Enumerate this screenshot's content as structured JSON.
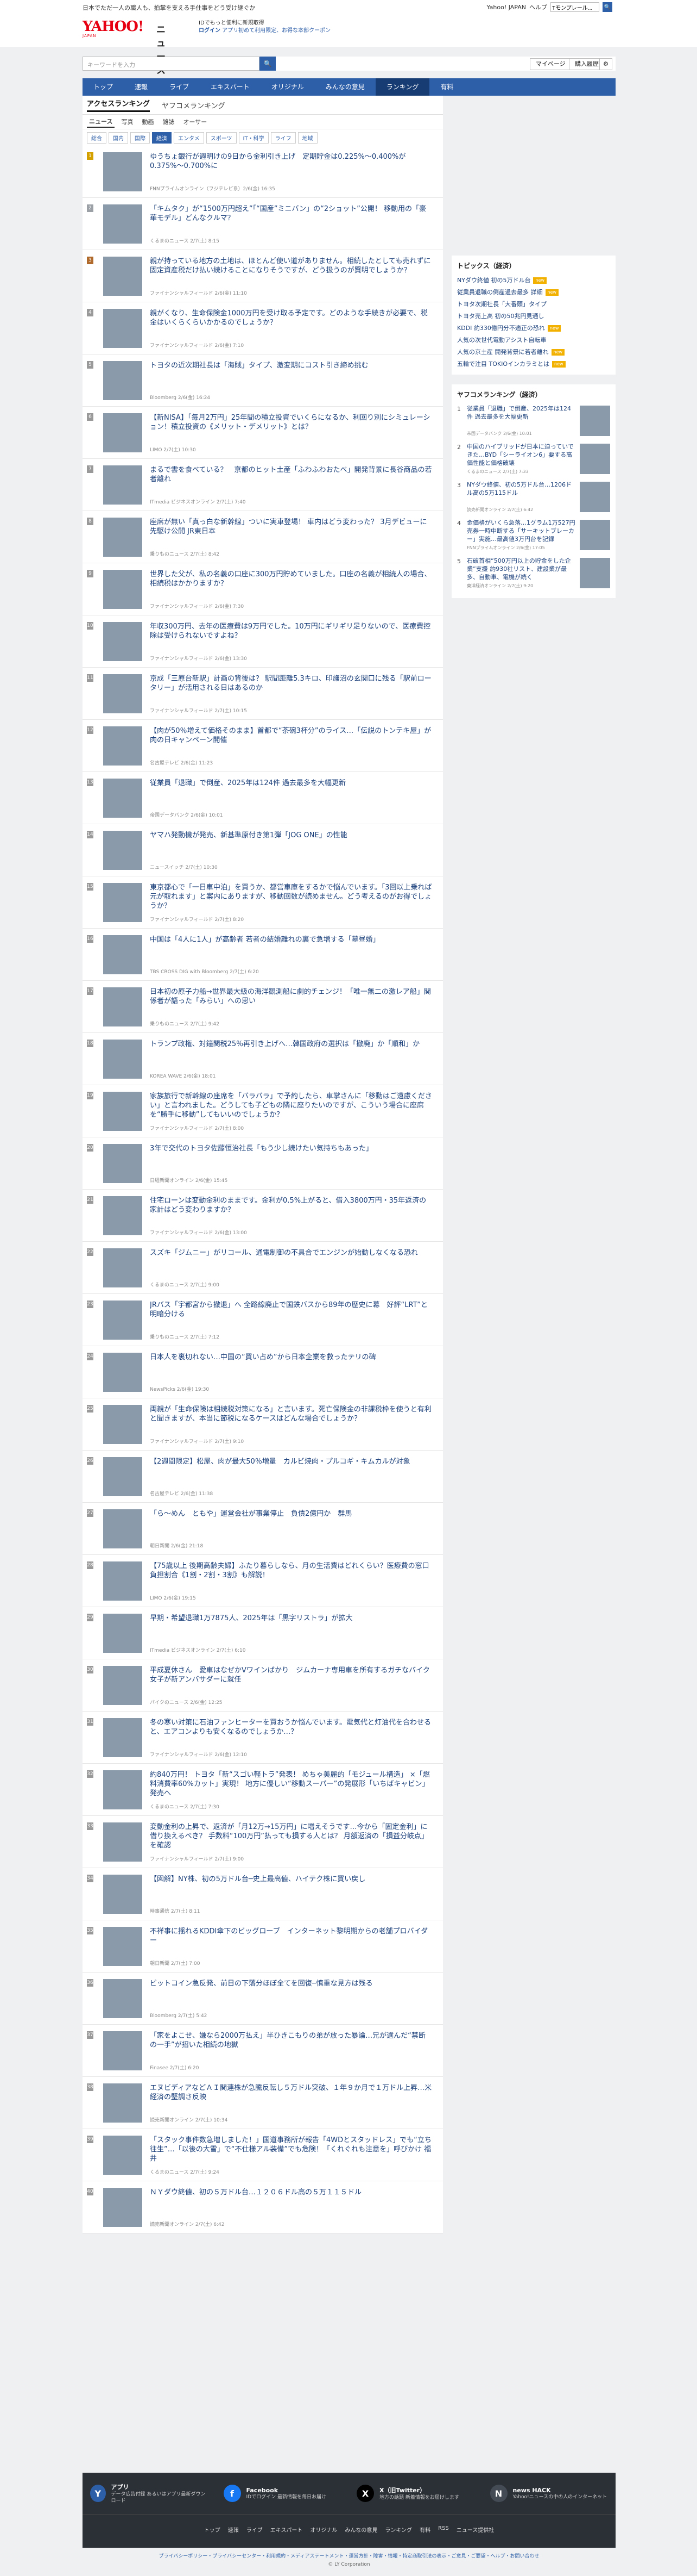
{
  "topbar": {
    "notice": "日本でただ一人の職人も、拍掌を支える手仕事をどう受け継ぐか",
    "links": [
      "Yahoo! JAPAN",
      "ヘルプ"
    ],
    "search_placeholder": "ウェブ検索",
    "search_value": "Tモンプレール..."
  },
  "header": {
    "logo_text": "YAHOO!",
    "logo_sub": "JAPAN",
    "service_name": "ニュース",
    "promo_line1": "IDでもっと便利に新規取得",
    "promo_login": "ログイン",
    "promo_line2": "アプリ初めて利用限定、お得な本部クーポン"
  },
  "searchbar": {
    "placeholder": "キーワードを入力",
    "mypage": "マイページ",
    "purchase": "購入履歴"
  },
  "nav": {
    "items": [
      "トップ",
      "速報",
      "ライブ",
      "エキスパート",
      "オリジナル",
      "みんなの意見",
      "ランキング",
      "有料"
    ],
    "active": "ランキング"
  },
  "ranking": {
    "tabs": [
      "アクセスランキング",
      "ヤフコメランキング"
    ],
    "sub_tabs": [
      "ニュース",
      "写真",
      "動画",
      "雑誌",
      "オーサー"
    ],
    "categories": [
      "総合",
      "国内",
      "国際",
      "経済",
      "エンタメ",
      "スポーツ",
      "IT・科学",
      "ライフ",
      "地域"
    ],
    "active_category": "経済",
    "items": [
      {
        "rank": "1",
        "title": "ゆうちょ銀行が週明けの9日から金利引き上げ　定期貯金は0.225%～0.400%が0.375%～0.700%に",
        "source": "FNNプライムオンライン（フジテレビ系）2/6(金) 16:35"
      },
      {
        "rank": "2",
        "title": "「キムタク」が“1500万円超え”「“国産”ミニバン」の“2ショット”公開！ 移動用の「豪華モデル」どんなクルマ？",
        "source": "くるまのニュース 2/7(土) 8:15"
      },
      {
        "rank": "3",
        "title": "親が持っている地方の土地は、ほとんど使い道がありません。相続したとしても売れずに固定資産税だけ払い続けることになりそうですが、どう扱うのが賢明でしょうか？",
        "source": "ファイナンシャルフィールド 2/6(金) 11:10"
      },
      {
        "rank": "4",
        "title": "親がくなり、生命保険金1000万円を受け取る予定です。どのような手続きが必要で、税金はいくらくらいかかるのでしょうか？",
        "source": "ファイナンシャルフィールド 2/6(金) 7:10"
      },
      {
        "rank": "5",
        "title": "トヨタの近次期社長は「海賊」タイプ、激変期にコスト引き締め挑む",
        "source": "Bloomberg 2/6(金) 16:24"
      },
      {
        "rank": "6",
        "title": "【新NISA】「毎月2万円」25年間の積立投資でいくらになるか、利回り別にシミュレーション！積立投資の《メリット・デメリット》とは？",
        "source": "LIMO 2/7(土) 10:30"
      },
      {
        "rank": "7",
        "title": "まるで雲を食べている？　京都のヒット土産「ふわふわおたべ」開発背景に長谷商品の若者離れ",
        "source": "ITmedia ビジネスオンライン 2/7(土) 7:40"
      },
      {
        "rank": "8",
        "title": "座席が無い「真っ白な新幹線」ついに実車登場！ 車内はどう変わった？ 3月デビューに先駆け公開 JR東日本",
        "source": "乗りものニュース 2/7(土) 8:42"
      },
      {
        "rank": "9",
        "title": "世界した父が、私の名義の口座に300万円貯めていました。口座の名義が相続人の場合、相続税はかかりますか？",
        "source": "ファイナンシャルフィールド 2/6(金) 7:30"
      },
      {
        "rank": "10",
        "title": "年収300万円、去年の医療費は9万円でした。10万円にギリギリ足りないので、医療費控除は受けられないですよね？",
        "source": "ファイナンシャルフィールド 2/6(金) 13:30"
      },
      {
        "rank": "11",
        "title": "京成「三原台新駅」計画の背後は？ 駅間距離5.3キロ、印旛沼の玄関口に残る「駅前ロータリー」が活用される日はあるのか",
        "source": "ファイナンシャルフィールド 2/7(土) 10:15"
      },
      {
        "rank": "12",
        "title": "【肉が50％増えて価格そのまま】首都で“茶碗3杯分”のライス…「伝説のトンテキ屋」が肉の日キャンペーン開催",
        "source": "名古屋テレビ 2/6(金) 11:23"
      },
      {
        "rank": "13",
        "title": "従業員「退職」で倒産、2025年は124件 過去最多を大幅更新",
        "source": "帝国データバンク 2/6(金) 10:01"
      },
      {
        "rank": "14",
        "title": "ヤマハ発動機が発売、新基準原付き第1弾「JOG ONE」の性能",
        "source": "ニュースイッチ 2/7(土) 10:30"
      },
      {
        "rank": "15",
        "title": "東京都心で「一日車中泊」を買うか、都営車庫をするかで悩んでいます。「3回以上乗れば元が取れます」と案内にありますが、移動回数が読めません。どう考えるのがお得でしょうか？",
        "source": "ファイナンシャルフィールド 2/7(土) 8:20"
      },
      {
        "rank": "16",
        "title": "中国は「4人に1人」が高齢者 若者の結婚離れの裏で急増する「墓昼婚」",
        "source": "TBS CROSS DIG with Bloomberg 2/7(土) 6:20"
      },
      {
        "rank": "17",
        "title": "日本初の原子力船→世界最大級の海洋観測船に劇的チェンジ！「唯一無二の激レア船」関係者が語った「みらい」への思い",
        "source": "乗りものニュース 2/7(土) 9:42"
      },
      {
        "rank": "18",
        "title": "トランプ政権、対鐘関税25％再引き上げへ…韓国政府の選択は「撤廃」か「順和」か",
        "source": "KOREA WAVE 2/6(金) 18:01"
      },
      {
        "rank": "19",
        "title": "家族旅行で新幹線の座席を「バラバラ」で予約したら、車掌さんに「移動はご遠慮ください」と言われました。どうしても子どもの隣に座りたいのですが、こういう場合に座席を“勝手に移動”してもいいのでしょうか？",
        "source": "ファイナンシャルフィールド 2/7(土) 8:00"
      },
      {
        "rank": "20",
        "title": "3年で交代のトヨタ佐藤恒治社長「もう少し続けたい気持ちもあった」",
        "source": "日経新聞オンライン 2/6(金) 15:45"
      },
      {
        "rank": "21",
        "title": "住宅ローンは変動金利のままです。金利が0.5%上がると、借入3800万円・35年返済の家計はどう変わりますか？",
        "source": "ファイナンシャルフィールド 2/6(金) 13:00"
      },
      {
        "rank": "22",
        "title": "スズキ「ジムニー」がリコール、通電制御の不具合でエンジンが始動しなくなる恐れ",
        "source": "くるまのニュース 2/7(土) 9:00"
      },
      {
        "rank": "23",
        "title": "JRバス「宇都宮から撤退」へ 全路線廃止で国鉄バスから89年の歴史に幕　好評“LRT”と明暗分ける",
        "source": "乗りものニュース 2/7(土) 7:12"
      },
      {
        "rank": "24",
        "title": "日本人を裏切れない…中国の“買い占め”から日本企業を救ったテリの碑",
        "source": "NewsPicks 2/6(金) 19:30"
      },
      {
        "rank": "25",
        "title": "両親が「生命保険は相続税対策になる」と言います。死亡保険金の非課税枠を使うと有利と聞きますが、本当に節税になるケースはどんな場合でしょうか？",
        "source": "ファイナンシャルフィールド 2/7(土) 9:10"
      },
      {
        "rank": "26",
        "title": "【2週間限定】松屋、肉が最大50％増量　カルビ焼肉・プルコギ・キムカルが対象",
        "source": "名古屋テレビ 2/6(金) 11:38"
      },
      {
        "rank": "27",
        "title": "「ら～めん　ともや」運営会社が事業停止　負債2億円か　群馬",
        "source": "朝日新聞 2/6(金) 21:18"
      },
      {
        "rank": "28",
        "title": "【75歳以上 後期高齢夫婦】ふたり暮らしなら、月の生活費はどれくらい？医療費の窓口負担割合《1割・2割・3割》も解説！",
        "source": "LIMO 2/6(金) 19:15"
      },
      {
        "rank": "29",
        "title": "早期・希望退職1万7875人、2025年は「黒字リストラ」が拡大",
        "source": "ITmedia ビジネスオンライン 2/7(土) 6:10"
      },
      {
        "rank": "30",
        "title": "平成夏休さん　愛車はなぜかVワインばかり　ジムカーナ専用車を所有するガチなバイク女子が新アンバサダーに就任",
        "source": "バイクのニュース 2/6(金) 12:25"
      },
      {
        "rank": "31",
        "title": "冬の寒い対策に石油ファンヒーターを買おうか悩んでいます。電気代と灯油代を合わせると、エアコンよりも安くなるのでしょうか…？",
        "source": "ファイナンシャルフィールド 2/6(金) 12:10"
      },
      {
        "rank": "32",
        "title": "約840万円！ トヨタ「新“スゴい軽トラ”発表！ めちゃ美麗的「モジュール構造」 ×「燃料消費率60%カット」実現！ 地方に優しい“移動スーパー”の発展形「いちばキャビン」発売へ",
        "source": "くるまのニュース 2/7(土) 7:30"
      },
      {
        "rank": "33",
        "title": "変動金利の上昇で、返済が「月12万→15万円」に増えそうです…今から「固定金利」に借り換えるべき？ 手数料“100万円”払っても損する人とは？ 月額返済の「損益分岐点」を確認",
        "source": "ファイナンシャルフィールド 2/7(土) 9:00"
      },
      {
        "rank": "34",
        "title": "【図解】NY株、初の5万ドル台─史上最高値、ハイテク株に買い戻し",
        "source": "時事通信 2/7(土) 8:11"
      },
      {
        "rank": "35",
        "title": "不祥事に揺れるKDDI傘下のビッグローブ　インターネット黎明期からの老舗プロバイダー",
        "source": "朝日新聞 2/7(土) 7:00"
      },
      {
        "rank": "36",
        "title": "ビットコイン急反発、前日の下落分ほぼ全てを回復─慎重な見方は残る",
        "source": "Bloomberg 2/7(土) 5:42"
      },
      {
        "rank": "37",
        "title": "「家をよこせ、嫌なら2000万払え」半ひきこもりの弟が放った暴論…兄が選んだ“禁断の一手”が招いた相続の地獄",
        "source": "Finasee 2/7(土) 6:20"
      },
      {
        "rank": "38",
        "title": "エヌビディアなどＡＩ関連株が急騰反転し５万ドル突破、１年９か月で１万ドル上昇…米経済の堅調さ反映",
        "source": "読売新聞オンライン 2/7(土) 10:34"
      },
      {
        "rank": "39",
        "title": "「スタック事件数急増しました！」国道事務所が報告「4WDとスタッドレス」でも“立ち往生”…「以後の大雪」で“不仕様アル装備”でも危険！「くれぐれも注意を」呼びかけ 福井",
        "source": "くるまのニュース 2/7(土) 9:24"
      },
      {
        "rank": "40",
        "title": "ＮＹダウ終値、初の５万ドル台…１２０６ドル高の５万１１５ドル",
        "source": "読売新聞オンライン 2/7(土) 6:42"
      }
    ]
  },
  "sidebar": {
    "topics_title": "トピックス（経済）",
    "topics": [
      {
        "text": "NYダウ終値 初の5万ドル台",
        "badge": "new"
      },
      {
        "text": "従業員退職の倒産過去最多 詳細",
        "badge": "new"
      },
      {
        "text": "トヨタ次期社長「大番頭」タイプ",
        "badge": ""
      },
      {
        "text": "トヨタ売上高 初の50兆円見通し",
        "badge": ""
      },
      {
        "text": "KDDI 約330億円分不適正の恐れ",
        "badge": "new"
      },
      {
        "text": "人気の次世代電動アシスト自転車",
        "badge": ""
      },
      {
        "text": "人気の京土産 開発背景に若者離れ",
        "badge": "new"
      },
      {
        "text": "五輪で注目 TOKIOインカラミとは",
        "badge": "new"
      }
    ],
    "yahoo_title": "ヤフコメランキング（経済）",
    "yahoo_items": [
      {
        "rank": "1",
        "title": "従業員「退職」で倒産、2025年は124件 過去最多を大幅更新",
        "source": "帝国データバンク 2/6(金) 10:01"
      },
      {
        "rank": "2",
        "title": "中国のハイブリッドが日本に迫っていできた…BYD「シーライオン6」要する高価性能と価格破壊",
        "source": "くるまのニュース 2/7(土) 7:33"
      },
      {
        "rank": "3",
        "title": "NYダウ終値、初の5万ドル台…1206ドル高の5万115ドル",
        "source": "読売新聞オンライン 2/7(土) 6:42"
      },
      {
        "rank": "4",
        "title": "金価格がいくら急落…1グラム1万527円 売券一時中断する「サーキットブレーカー」実施…最高値3万円台を記録",
        "source": "FNNプライムオンライン 2/6(金) 17:05"
      },
      {
        "rank": "5",
        "title": "石破首相“500万円以上の貯金をした企業”支援 約930社リスト、建設業が最多、自動車、電機が続く",
        "source": "東洋経済オンライン 2/7(土) 9:20"
      }
    ]
  },
  "footer": {
    "apps": [
      {
        "icon": "Y",
        "name": "アプリ",
        "desc": "データ広告付録 あるいはアプリ最新ダウンロード"
      },
      {
        "icon": "f",
        "name": "Facebook",
        "desc": "IDでログイン 最新情報を毎日お届け"
      },
      {
        "icon": "X",
        "name": "X（旧Twitter）",
        "desc": "地方の話題 新着情報をお届けします"
      },
      {
        "icon": "N",
        "name": "news HACK",
        "desc": "Yahoo!ニュースの中の人のインターネット"
      }
    ],
    "nav": [
      "トップ",
      "速報",
      "ライブ",
      "エキスパート",
      "オリジナル",
      "みんなの意見",
      "ランキング",
      "有料",
      "RSS",
      "ニュース提供社"
    ],
    "legal": "プライバシーポリシー・プライバシーセンター・利用規約・メディアステートメント・運営方針・障害・情報・特定商取引法の表示・ご意見・ご要望・ヘルプ・お問い合わせ",
    "copyright": "© LY Corporation"
  }
}
